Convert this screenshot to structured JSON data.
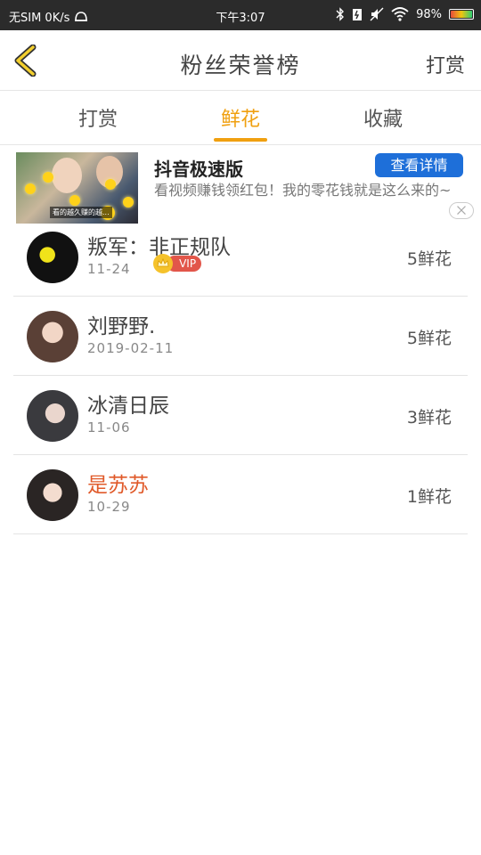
{
  "status_bar": {
    "carrier": "无SIM 0K/s",
    "time": "下午3:07",
    "battery": "98%"
  },
  "header": {
    "title": "粉丝荣誉榜",
    "right_action": "打赏"
  },
  "tabs": [
    {
      "label": "打赏",
      "active": false
    },
    {
      "label": "鲜花",
      "active": true
    },
    {
      "label": "收藏",
      "active": false
    }
  ],
  "ad": {
    "title": "抖音极速版",
    "description": "看视频赚钱领红包！我的零花钱就是这么来的~",
    "button": "查看详情",
    "thumb_caption": "看的越久赚的越..."
  },
  "fans": [
    {
      "name": "叛军：非正规队",
      "date": "11-24",
      "count": "5鲜花",
      "vip": false
    },
    {
      "name": "刘野野.",
      "date": "2019-02-11",
      "count": "5鲜花",
      "vip": false
    },
    {
      "name": "冰清日辰",
      "date": "11-06",
      "count": "3鲜花",
      "vip": false
    },
    {
      "name": "是苏苏",
      "date": "10-29",
      "count": "1鲜花",
      "vip": true,
      "vip_label": "VIP"
    }
  ],
  "colors": {
    "accent": "#f0a010",
    "status_bar": "#2b2b2b",
    "ad_button": "#1e6fd9",
    "vip_name": "#e05a2a"
  }
}
